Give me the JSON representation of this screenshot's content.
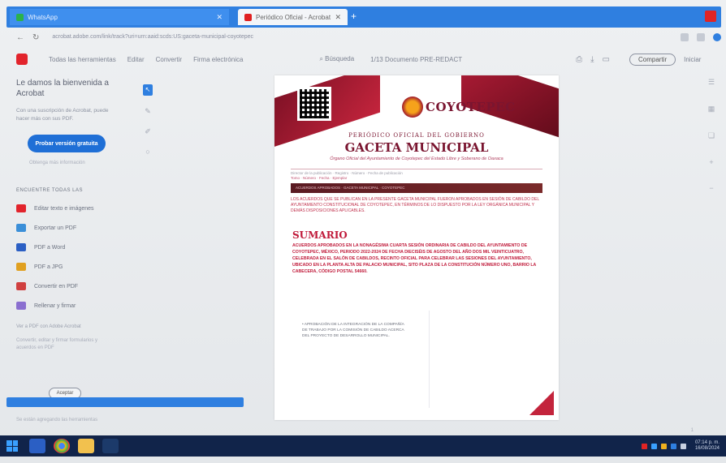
{
  "browser": {
    "tabs": [
      {
        "label": "WhatsApp"
      },
      {
        "label": "Periódico Oficial - Acrobat"
      }
    ],
    "url": "acrobat.adobe.com/link/track?uri=urn:aaid:scds:US:gaceta-municipal-coyotepec"
  },
  "acrobat": {
    "menu": [
      "Todas las herramientas",
      "Editar",
      "Convertir",
      "Firma electrónica"
    ],
    "search_label": "Búsqueda",
    "page_indicator": "1/13  Documento  PRE-REDACT",
    "share_label": "Compartir",
    "signin_label": "Iniciar"
  },
  "left_panel": {
    "welcome": "Le damos la bienvenida a Acrobat",
    "welcome_sub": "Con una suscripción de Acrobat, puede hacer más con sus PDF.",
    "trial_label": "Probar versión gratuita",
    "learn_more": "Obtenga más información",
    "section_header": "ENCUENTRE TODAS LAS",
    "tools": [
      {
        "label": "Editar texto e imágenes",
        "color": "#e2242c"
      },
      {
        "label": "Exportar un PDF",
        "color": "#3b8fd8"
      },
      {
        "label": "PDF a Word",
        "color": "#2b5fc4"
      },
      {
        "label": "PDF a JPG",
        "color": "#e0a020"
      },
      {
        "label": "Convertir en PDF",
        "color": "#d04040"
      },
      {
        "label": "Rellenar y firmar",
        "color": "#8a6fd0"
      }
    ],
    "footer_link": "Ver a PDF con Adobe Acrobat",
    "footer_text": "Convertir, editar y firmar formularios y acuerdos en PDF",
    "notif_button": "Aceptar"
  },
  "document": {
    "brand": "COYOTEPEC",
    "periodico": "PERIÓDICO OFICIAL DEL GOBIERNO",
    "title": "GACETA MUNICIPAL",
    "tagline": "Órgano Oficial del Ayuntamiento de Coyotepec del Estado Libre y Soberano de Oaxaca",
    "rule_line": "Director de la publicación · Registro · Número · Fecha de publicación",
    "rule_line_2": "Tomo · Número · Fecha · Ejemplar",
    "band_text": "ACUERDOS APROBADOS · GACETA MUNICIPAL · COYOTEPEC",
    "red_para": "LOS ACUERDOS QUE SE PUBLICAN EN LA PRESENTE GACETA MUNICIPAL FUERON APROBADOS EN SESIÓN DE CABILDO DEL AYUNTAMIENTO CONSTITUCIONAL DE COYOTEPEC, EN TÉRMINOS DE LO DISPUESTO POR LA LEY ORGÁNICA MUNICIPAL Y DEMÁS DISPOSICIONES APLICABLES.",
    "sumario_title": "SUMARIO",
    "sumario_body": "ACUERDOS APROBADOS EN LA NONAGÉSIMA CUARTA SESIÓN ORDINARIA DE CABILDO DEL AYUNTAMIENTO DE COYOTEPEC, MÉXICO, PERIODO 2022-2024 DE FECHA DIECISÉIS DE AGOSTO DEL AÑO DOS MIL VEINTICUATRO, CELEBRADA EN EL SALÓN DE CABILDOS, RECINTO OFICIAL PARA CELEBRAR LAS SESIONES DEL AYUNTAMIENTO, UBICADO EN LA PLANTA ALTA DE PALACIO MUNICIPAL, SITO PLAZA DE LA CONSTITUCIÓN NÚMERO UNO, BARRIO LA CABECERA, CÓDIGO POSTAL 54660.",
    "bullet": "• APROBACIÓN DE LA INTEGRACIÓN DE LA COMPAÑÍA DE TRABAJO POR LA COMISIÓN DE CABILDO ACERCA DEL PROYECTO DE DESARROLLO MUNICIPAL."
  },
  "taskbar": {
    "time": "07:14 p. m.",
    "date": "16/08/2024"
  },
  "status": "Se están agregando las herramientas"
}
